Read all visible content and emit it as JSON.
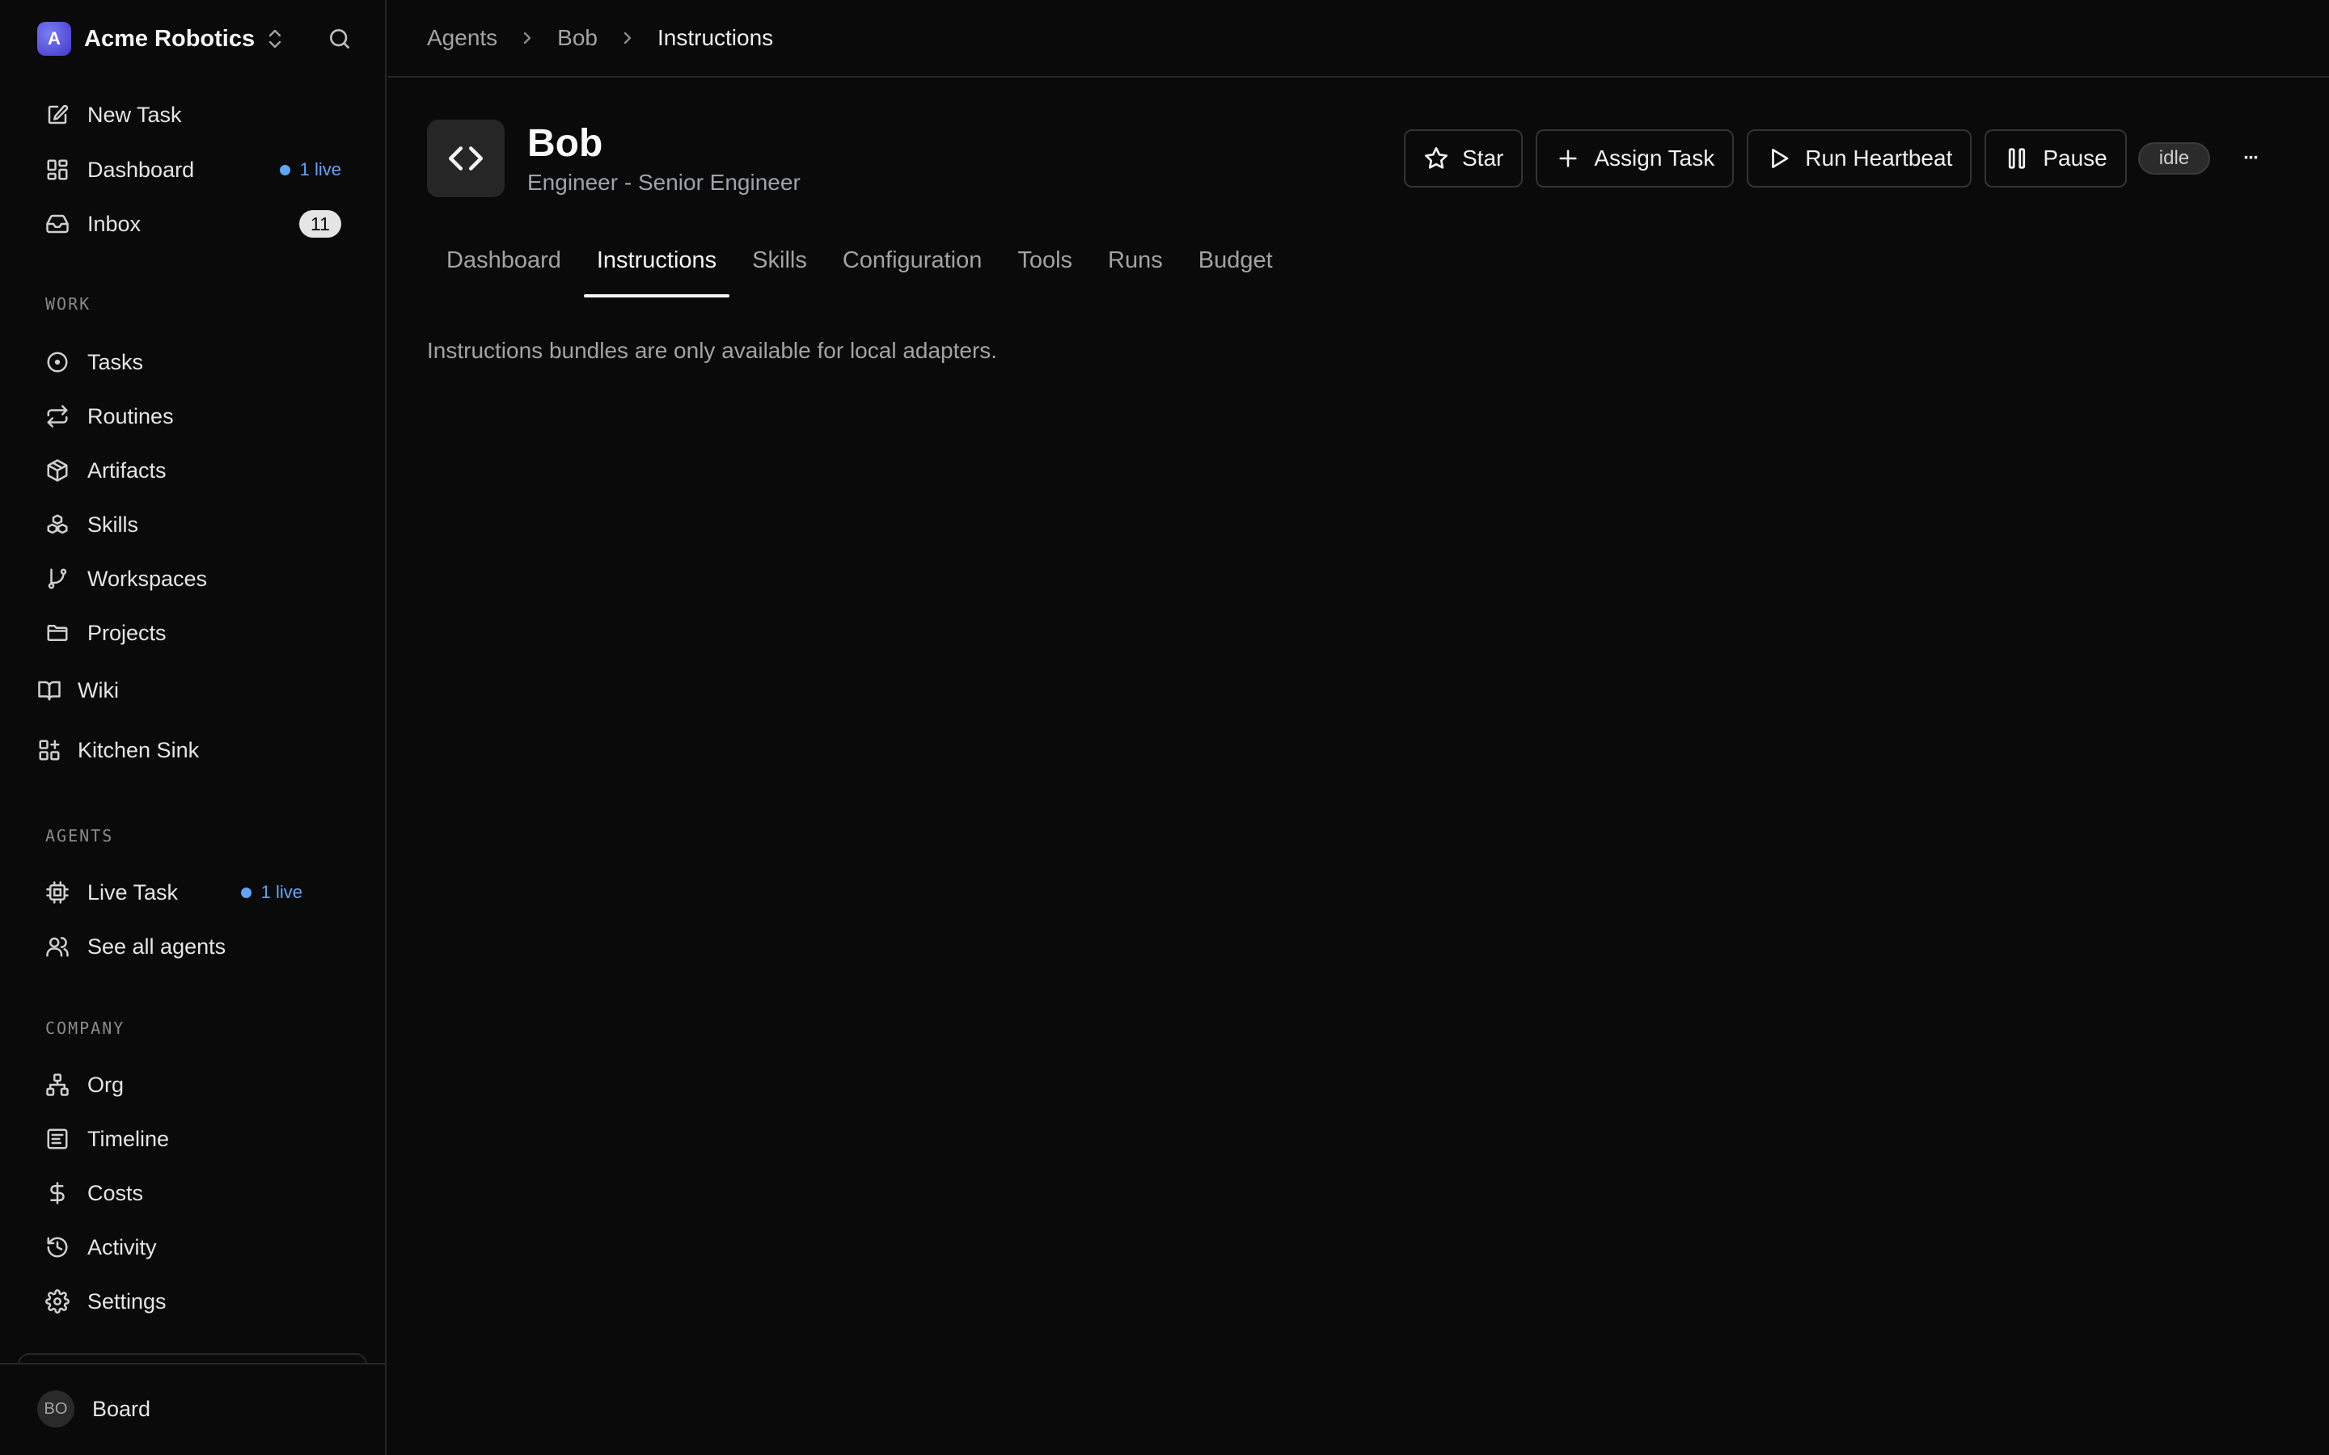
{
  "sidebar": {
    "company": {
      "logo_letter": "A",
      "name": "Acme Robotics"
    },
    "top_items": [
      {
        "label": "New Task",
        "icon": "pencil-square-icon"
      },
      {
        "label": "Dashboard",
        "icon": "dashboard-grid-icon",
        "live_text": "1 live"
      },
      {
        "label": "Inbox",
        "icon": "inbox-icon",
        "count": "11"
      }
    ],
    "work": {
      "label": "WORK",
      "items": [
        {
          "label": "Tasks",
          "icon": "circle-dot-icon"
        },
        {
          "label": "Routines",
          "icon": "repeat-icon"
        },
        {
          "label": "Artifacts",
          "icon": "box-icon"
        },
        {
          "label": "Skills",
          "icon": "boxes-icon"
        },
        {
          "label": "Workspaces",
          "icon": "git-branch-icon"
        },
        {
          "label": "Projects",
          "icon": "folder-icon"
        },
        {
          "label": "Wiki",
          "icon": "book-icon"
        },
        {
          "label": "Kitchen Sink",
          "icon": "grid-plus-icon"
        }
      ]
    },
    "agents": {
      "label": "AGENTS",
      "items": [
        {
          "label": "Live Task",
          "icon": "cpu-icon",
          "live_text": "1 live"
        },
        {
          "label": "See all agents",
          "icon": "users-icon"
        }
      ]
    },
    "company_section": {
      "label": "COMPANY",
      "items": [
        {
          "label": "Org",
          "icon": "org-chart-icon"
        },
        {
          "label": "Timeline",
          "icon": "timeline-icon"
        },
        {
          "label": "Costs",
          "icon": "dollar-icon"
        },
        {
          "label": "Activity",
          "icon": "history-icon"
        },
        {
          "label": "Settings",
          "icon": "gear-icon"
        }
      ]
    },
    "footer": {
      "avatar_initials": "BO",
      "label": "Board"
    }
  },
  "breadcrumb": [
    "Agents",
    "Bob",
    "Instructions"
  ],
  "agent": {
    "name": "Bob",
    "role": "Engineer - Senior Engineer",
    "status": "idle"
  },
  "actions": {
    "star": "Star",
    "assign_task": "Assign Task",
    "run_heartbeat": "Run Heartbeat",
    "pause": "Pause",
    "more": "···"
  },
  "tabs": [
    {
      "label": "Dashboard",
      "active": false
    },
    {
      "label": "Instructions",
      "active": true
    },
    {
      "label": "Skills",
      "active": false
    },
    {
      "label": "Configuration",
      "active": false
    },
    {
      "label": "Tools",
      "active": false
    },
    {
      "label": "Runs",
      "active": false
    },
    {
      "label": "Budget",
      "active": false
    }
  ],
  "content": {
    "message": "Instructions bundles are only available for local adapters."
  },
  "colors": {
    "background": "#0a0a0a",
    "border": "#262626",
    "accent_live": "#60a5fa",
    "brand": "#4338ca"
  }
}
